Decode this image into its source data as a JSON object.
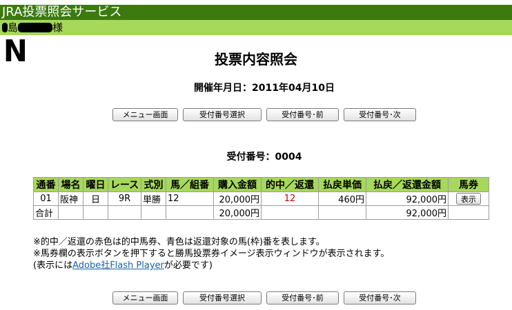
{
  "header": {
    "title": "JRA投票照会サービス",
    "user_suffix": "様",
    "user_visible_char": "島"
  },
  "logo_mark": "N",
  "page_title": "投票内容照会",
  "date_line": "開催年月日：2011年04月10日",
  "nav_buttons": {
    "menu": "メニュー画面",
    "select": "受付番号選択",
    "prev": "受付番号･前",
    "next": "受付番号･次"
  },
  "receipt_line": "受付番号：0004",
  "table": {
    "headers": [
      "通番",
      "場名",
      "曜日",
      "レース",
      "式別",
      "馬／組番",
      "購入金額",
      "的中／返還",
      "払戻単価",
      "払戻／返還金額",
      "馬券"
    ],
    "row": {
      "no": "01",
      "venue": "阪神",
      "day": "日",
      "race": "9R",
      "bet_type": "単勝",
      "combo": "12",
      "amount": "20,000円",
      "hit": "12",
      "unit_payout": "460円",
      "payout": "92,000円",
      "ticket_button": "表示"
    },
    "total": {
      "label": "合計",
      "amount": "20,000円",
      "payout": "92,000円"
    }
  },
  "notes": {
    "line1": "※的中／返還の赤色は的中馬券、青色は返還対象の馬(枠)番を表します。",
    "line2": "※馬券欄の表示ボタンを押下すると勝馬投票券イメージ表示ウィンドウが表示されます。",
    "line3_prefix": "(表示には",
    "line3_link": "Adobe社Flash Player",
    "line3_suffix": "が必要です)"
  },
  "colors": {
    "title_bar": "#3c7a10",
    "user_bar": "#a6d85a",
    "header_cells": "#a6d85a",
    "hit_text": "#c00000",
    "link": "#1a5fa8"
  }
}
